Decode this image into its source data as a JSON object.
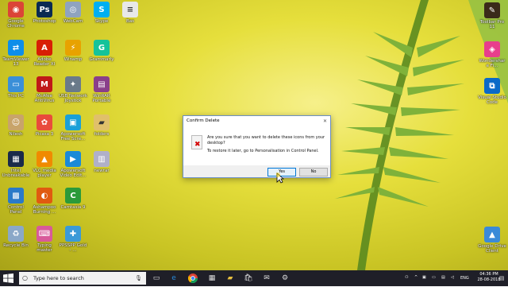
{
  "desktop": {
    "left_icons": [
      {
        "label": "Google Chrome",
        "icon": "chrome-icon",
        "color": "#db4437",
        "glyph": "◉"
      },
      {
        "label": "Photoshop",
        "icon": "photoshop-icon",
        "color": "#0a2a52",
        "glyph": "Ps"
      },
      {
        "label": "WebCam",
        "icon": "webcam-icon",
        "color": "#8fa3bf",
        "glyph": "◎"
      },
      {
        "label": "Skype",
        "icon": "skype-icon",
        "color": "#00aff0",
        "glyph": "S"
      },
      {
        "label": "Bas",
        "icon": "file-icon",
        "color": "#e8e8e8",
        "glyph": "≡"
      },
      {
        "label": "TeamViewer 13",
        "icon": "teamviewer-icon",
        "color": "#0e8ee9",
        "glyph": "⇄"
      },
      {
        "label": "Adobe Reader XI",
        "icon": "adobe-reader-icon",
        "color": "#d81e05",
        "glyph": "A"
      },
      {
        "label": "Winamp",
        "icon": "winamp-icon",
        "color": "#e8a200",
        "glyph": "⚡"
      },
      {
        "label": "Grammarly",
        "icon": "grammarly-icon",
        "color": "#15c39a",
        "glyph": "G"
      },
      {
        "label": "This PC",
        "icon": "this-pc-icon",
        "color": "#3a8fd8",
        "glyph": "▭"
      },
      {
        "label": "McAfee AntiVirus",
        "icon": "mcafee-icon",
        "color": "#c01818",
        "glyph": "M"
      },
      {
        "label": "USB Network Joystick",
        "icon": "joystick-icon",
        "color": "#6a7a8a",
        "glyph": "✦"
      },
      {
        "label": "WinRAR Portable",
        "icon": "winrar-icon",
        "color": "#8a3f8a",
        "glyph": "▤"
      },
      {
        "label": "Nilesh",
        "icon": "user-folder-icon",
        "color": "#c8a46a",
        "glyph": "☺"
      },
      {
        "label": "Picasa 3",
        "icon": "picasa-icon",
        "color": "#e94b3c",
        "glyph": "✿"
      },
      {
        "label": "Apowersoft Free Scre...",
        "icon": "apowersoft-icon",
        "color": "#1aa0d8",
        "glyph": "▣"
      },
      {
        "label": "folders",
        "icon": "folder-icon",
        "color": "#e0c06a",
        "glyph": "▰"
      },
      {
        "label": "Intel Unbreakable",
        "icon": "intel-icon",
        "color": "#1a2a4a",
        "glyph": "▦"
      },
      {
        "label": "VLC media player",
        "icon": "vlc-icon",
        "color": "#f08a00",
        "glyph": "▲"
      },
      {
        "label": "Apowersoft Video Edit...",
        "icon": "video-editor-icon",
        "color": "#1a8ad8",
        "glyph": "▶"
      },
      {
        "label": "newrar",
        "icon": "rar-file-icon",
        "color": "#b0b0c8",
        "glyph": "▥"
      },
      {
        "label": "Control Panel",
        "icon": "control-panel-icon",
        "color": "#2a7ac8",
        "glyph": "▩"
      },
      {
        "label": "Ashampoo Burning ...",
        "icon": "ashampoo-icon",
        "color": "#e05a10",
        "glyph": "◐"
      },
      {
        "label": "Camtasia 9",
        "icon": "camtasia-icon",
        "color": "#2a9a3a",
        "glyph": "C"
      },
      {
        "label": "Recycle Bin",
        "icon": "recycle-bin-icon",
        "color": "#8aa8c8",
        "glyph": "♻"
      },
      {
        "label": "Typing master",
        "icon": "typing-master-icon",
        "color": "#d85a9a",
        "glyph": "⌨"
      },
      {
        "label": "PPSSPP Gold - ...",
        "icon": "ppsspp-icon",
        "color": "#3a9ad8",
        "glyph": "✚"
      }
    ],
    "right_icons": [
      {
        "label": "Toolbar Pro 11",
        "icon": "toolbar-pro-icon",
        "color": "#3a2a1a",
        "glyph": "✎"
      },
      {
        "label": "Wondershare Fi...",
        "icon": "wondershare-icon",
        "color": "#e83e8c",
        "glyph": "◈"
      },
      {
        "label": "Visual Studio Code",
        "icon": "vscode-icon",
        "color": "#0a6ac8",
        "glyph": "⧉"
      },
      {
        "label": "Google Drive Client",
        "icon": "gdrive-icon",
        "color": "#3a8ad8",
        "glyph": "▲"
      }
    ]
  },
  "dialog": {
    "title": "Confirm Delete",
    "message": "Are you sure that you want to delete these icons from your desktop?",
    "restore_note": "To restore it later, go to Personalisation in Control Panel.",
    "yes_label": "Yes",
    "no_label": "No"
  },
  "taskbar": {
    "search_placeholder": "Type here to search",
    "language": "ENG",
    "time": "04:36 PM",
    "date": "28-08-2018"
  }
}
